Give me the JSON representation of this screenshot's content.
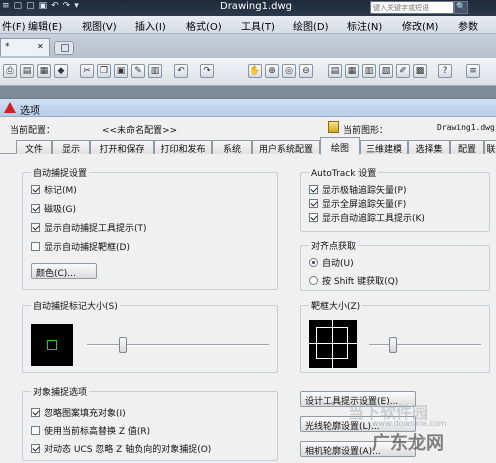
{
  "titlebar": {
    "quick_access": [
      "≡",
      "▢",
      "▢",
      "▣",
      "↶",
      "↷",
      "▾"
    ],
    "document": "Drawing1.dwg",
    "search_placeholder": "键入关键字或短语",
    "search_btn": "🔍"
  },
  "menubar": {
    "items": [
      "件(F)",
      "编辑(E)",
      "视图(V)",
      "插入(I)",
      "格式(O)",
      "工具(T)",
      "绘图(D)",
      "标注(N)",
      "修改(M)",
      "参数"
    ]
  },
  "tabstrip": {
    "doc_tab_label": "*",
    "close": "✕"
  },
  "toolbar": {
    "icons": [
      "printer-icon",
      "open-icon",
      "save-icon",
      "plot-icon",
      "cut-icon",
      "copy-icon",
      "paste-icon",
      "match-icon",
      "undo-icon",
      "redo-icon",
      "pan-icon",
      "zoom-icon",
      "zoom-window-icon",
      "zoom-prev-icon",
      "properties-icon",
      "design-center-icon",
      "tool-palette-icon",
      "sheet-set-icon",
      "markup-icon",
      "calc-icon",
      "help-icon"
    ]
  },
  "dialog": {
    "title": "选项",
    "current_config_label": "当前配置：",
    "current_config_value": "<<未命名配置>>",
    "current_drawing_label": "当前图形：",
    "current_drawing_value": "Drawing1.dwg",
    "tabs": [
      "文件",
      "显示",
      "打开和保存",
      "打印和发布",
      "系统",
      "用户系统配置",
      "绘图",
      "三维建模",
      "选择集",
      "配置",
      "联"
    ],
    "active_tab": "绘图",
    "autosnap": {
      "title": "自动捕捉设置",
      "items": [
        {
          "label": "标记(M)",
          "checked": true
        },
        {
          "label": "磁吸(G)",
          "checked": true
        },
        {
          "label": "显示自动捕捉工具提示(T)",
          "checked": true
        },
        {
          "label": "显示自动捕捉靶框(D)",
          "checked": false
        }
      ],
      "color_button": "颜色(C)..."
    },
    "autotrack": {
      "title": "AutoTrack 设置",
      "items": [
        {
          "label": "显示极轴追踪矢量(P)",
          "checked": true
        },
        {
          "label": "显示全屏追踪矢量(F)",
          "checked": true
        },
        {
          "label": "显示自动追踪工具提示(K)",
          "checked": true
        }
      ]
    },
    "alignment": {
      "title": "对齐点获取",
      "options": [
        {
          "label": "自动(U)",
          "selected": true
        },
        {
          "label": "按 Shift 键获取(Q)",
          "selected": false
        }
      ]
    },
    "marker_size": {
      "title": "自动捕捉标记大小(S)"
    },
    "aperture_size": {
      "title": "靶框大小(Z)"
    },
    "object_snap": {
      "title": "对象捕捉选项",
      "items": [
        {
          "label": "忽略图案填充对象(I)",
          "checked": true
        },
        {
          "label": "使用当前标高替换 Z 值(R)",
          "checked": false
        },
        {
          "label": "对动态 UCS 忽略 Z 轴负向的对象捕捉(O)",
          "checked": true
        }
      ]
    },
    "right_buttons": [
      "设计工具提示设置(E)...",
      "光线轮廓设置(L)...",
      "相机轮廓设置(A)..."
    ],
    "watermark": {
      "cn": "当下软件园",
      "en": "www.downxia.com",
      "cn2": "广东龙网"
    }
  }
}
